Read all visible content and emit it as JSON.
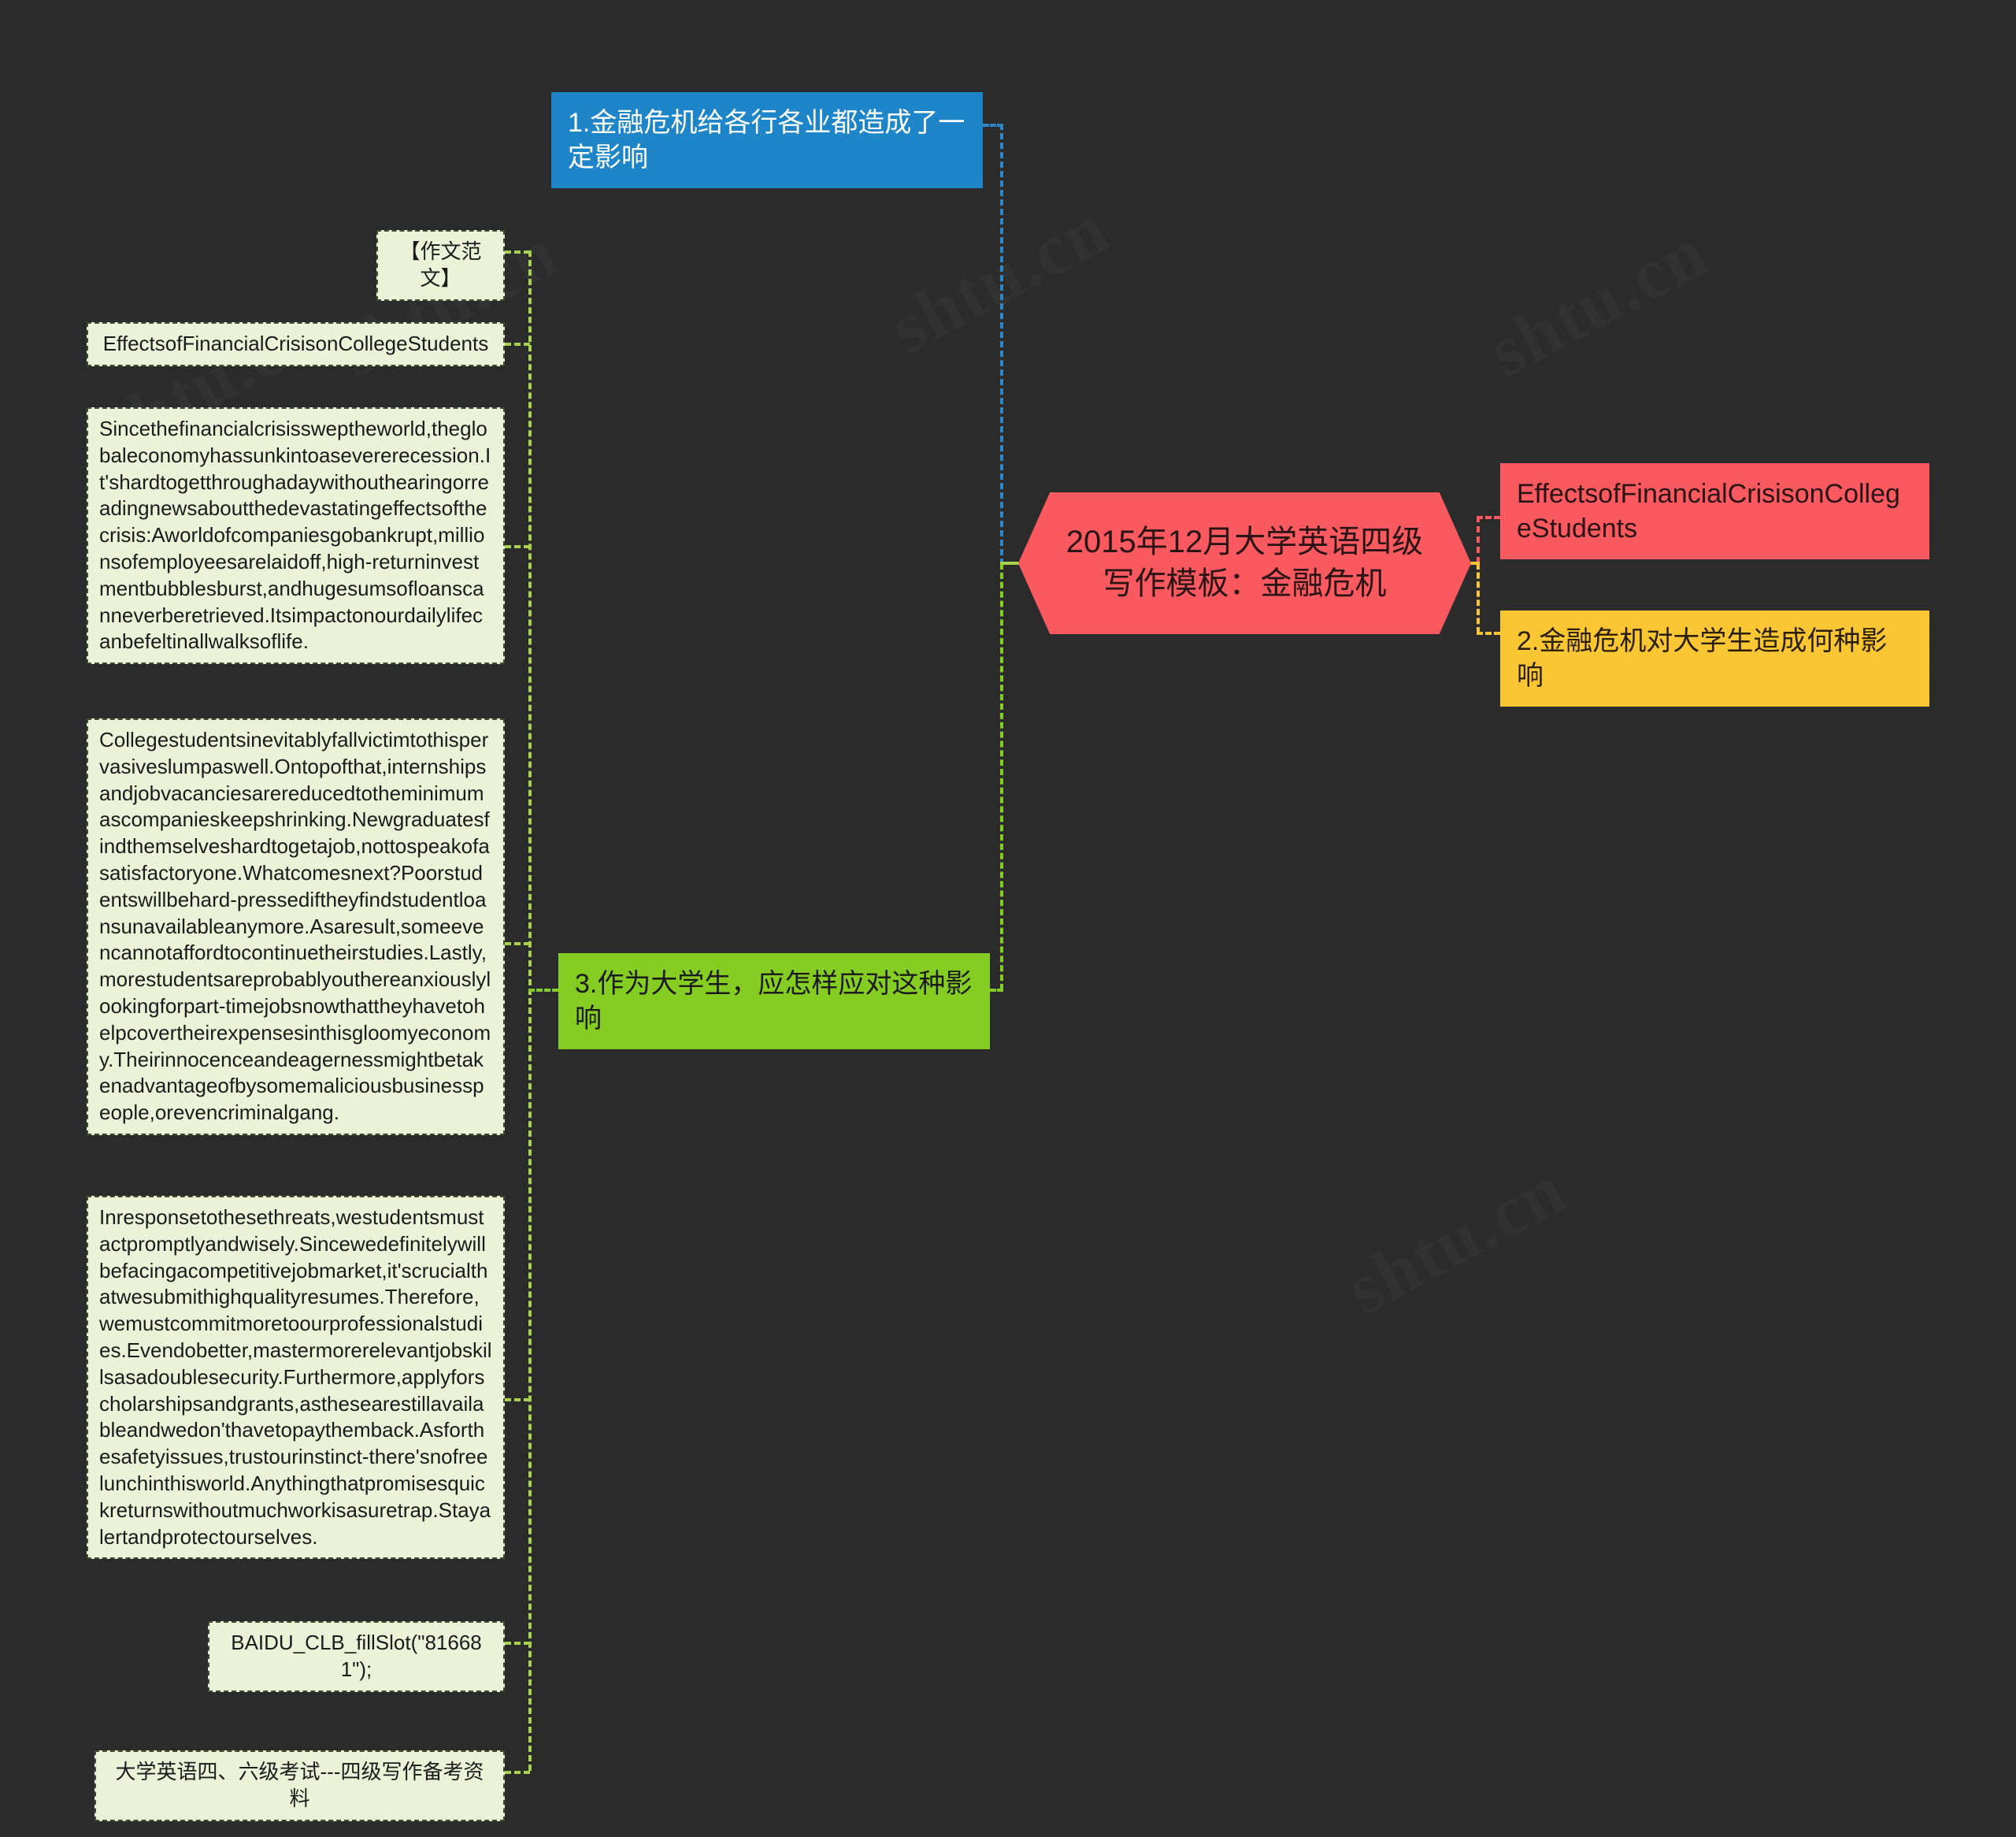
{
  "central": {
    "label": "2015年12月大学英语四级\n写作模板：金融危机",
    "color": "#fa5a5f"
  },
  "topics": [
    {
      "id": "topic-1",
      "label": "1.金融危机给各行各业都造成了一定影响",
      "color": "#1d85c8",
      "side": "left"
    },
    {
      "id": "topic-3",
      "label": "3.作为大学生，应怎样应对这种影响",
      "color": "#86cd23",
      "side": "left"
    },
    {
      "id": "topic-essay-title",
      "label": "EffectsofFinancialCrisisonCollegeStudents",
      "color": "#fa5a5f",
      "side": "right"
    },
    {
      "id": "topic-2",
      "label": "2.金融危机对大学生造成何种影响",
      "color": "#fbc633",
      "side": "right"
    }
  ],
  "leaves": [
    {
      "id": "leaf-sample-essay",
      "label": "【作文范文】"
    },
    {
      "id": "leaf-essay-heading",
      "label": "EffectsofFinancialCrisisonCollegeStudents"
    },
    {
      "id": "leaf-paragraph-1",
      "label": "Sincethefinancialcrisissweptheworld,theglobaleconomyhassunkintoasevererecession.It'shardtogetthroughadaywithouthearingorreadingnewsaboutthedevastatingeffectsofthecrisis:Aworldofcompaniesgobankrupt,millionsofemployeesarelaidoff,high-returninvestmentbubblesburst,andhugesumsofloanscanneverberetrieved.Itsimpactonourdailylifecanbefeltinallwalksoflife."
    },
    {
      "id": "leaf-paragraph-2",
      "label": "Collegestudentsinevitablyfallvictimtothispervasiveslumpaswell.Ontopofthat,internshipsandjobvacanciesarereducedtotheminimumascompanieskeepshrinking.Newgraduatesfindthemselveshardtogetajob,nottospeakofasatisfactoryone.Whatcomesnext?Poorstudentswillbehard-pressediftheyfindstudentloansunavailableanymore.Asaresult,someevencannotaffordtocontinuetheirstudies.Lastly,morestudentsareprobablyouthereanxiouslylookingforpart-timejobsnowthattheyhavetohelpcovertheirexpensesinthisgloomyeconomy.Theirinnocenceandeagernessmightbetakenadvantageofbysomemaliciousbusinesspeople,orevencriminalgang."
    },
    {
      "id": "leaf-paragraph-3",
      "label": "Inresponsetothesethreats,westudentsmustactpromptlyandwisely.Sincewedefinitelywillbefacingacompetitivejobmarket,it'scrucialthatwesubmithighqualityresumes.Therefore,wemustcommitmoretoourprofessionalstudies.Evendobetter,mastermorerelevantjobskillsasadoublesecurity.Furthermore,applyforscholarshipsandgrants,asthesearestillavailableandwedon'thavetopaythemback.Asforthesafetyissues,trustourinstinct-there'snofreelunchinthisworld.Anythingthatpromisesquickreturnswithoutmuchworkisasuretrap.Stayalertandprotectourselves."
    },
    {
      "id": "leaf-ad-slot",
      "label": "BAIDU_CLB_fillSlot(\"816681\");"
    },
    {
      "id": "leaf-footer",
      "label": "大学英语四、六级考试---四级写作备考资料"
    }
  ],
  "connectors": {
    "left_trunk_color": "#a8d24b",
    "blue_color": "#2f86c5",
    "green_color": "#86cd23",
    "red_color": "#fa5a5f",
    "yellow_color": "#fbc633"
  },
  "watermarks": [
    "shtu.cn",
    "shtu.cn",
    "shtu.cn",
    "shtu.cn",
    "shtu.cn",
    "shtu.cn"
  ]
}
